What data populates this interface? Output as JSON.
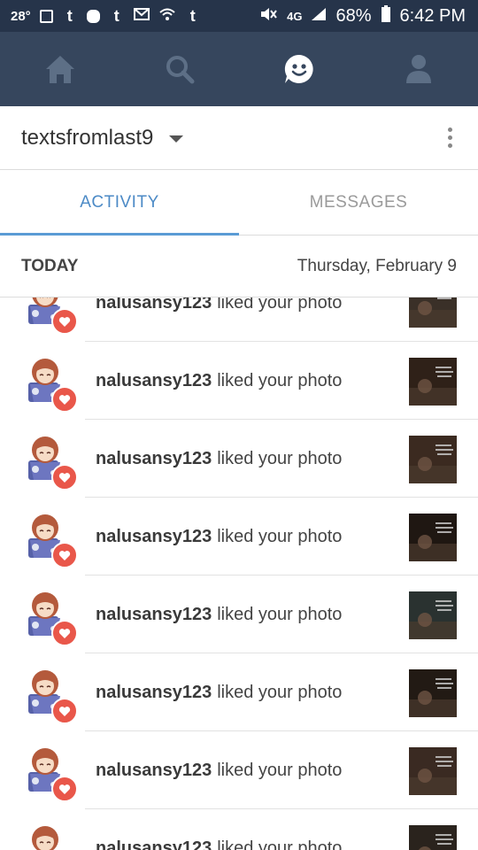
{
  "status_bar": {
    "temperature": "28°",
    "left_icons": [
      "image-icon",
      "tumblr-icon",
      "bitmoji-icon",
      "tumblr-icon",
      "mail-icon",
      "wifi-icon",
      "tumblr-icon"
    ],
    "right_icons": [
      "mute-icon",
      "4g-lte-icon",
      "signal-icon",
      "battery-icon"
    ],
    "network": "4G",
    "battery": "68%",
    "time": "6:42 PM"
  },
  "nav": {
    "items": [
      "home-icon",
      "search-icon",
      "activity-icon",
      "account-icon"
    ],
    "active": "activity-icon"
  },
  "account": {
    "name": "textsfromlast9"
  },
  "tabs": [
    {
      "label": "ACTIVITY",
      "active": true
    },
    {
      "label": "MESSAGES",
      "active": false
    }
  ],
  "section": {
    "title": "TODAY",
    "date": "Thursday, February 9"
  },
  "notifications": [
    {
      "user": "nalusansy123",
      "action": "liked your photo",
      "thumb_color": "#3a3028"
    },
    {
      "user": "nalusansy123",
      "action": "liked your photo",
      "thumb_color": "#2f2118"
    },
    {
      "user": "nalusansy123",
      "action": "liked your photo",
      "thumb_color": "#3b2a20"
    },
    {
      "user": "nalusansy123",
      "action": "liked your photo",
      "thumb_color": "#1f1712"
    },
    {
      "user": "nalusansy123",
      "action": "liked your photo",
      "thumb_color": "#2a3230"
    },
    {
      "user": "nalusansy123",
      "action": "liked your photo",
      "thumb_color": "#221a14"
    },
    {
      "user": "nalusansy123",
      "action": "liked your photo",
      "thumb_color": "#3a2a22"
    },
    {
      "user": "nalusansy123",
      "action": "liked your photo",
      "thumb_color": "#2a231d"
    }
  ],
  "colors": {
    "status_bar": "#26344a",
    "nav_bar": "#36465d",
    "accent": "#4c8ac6",
    "heart": "#e9574a"
  }
}
